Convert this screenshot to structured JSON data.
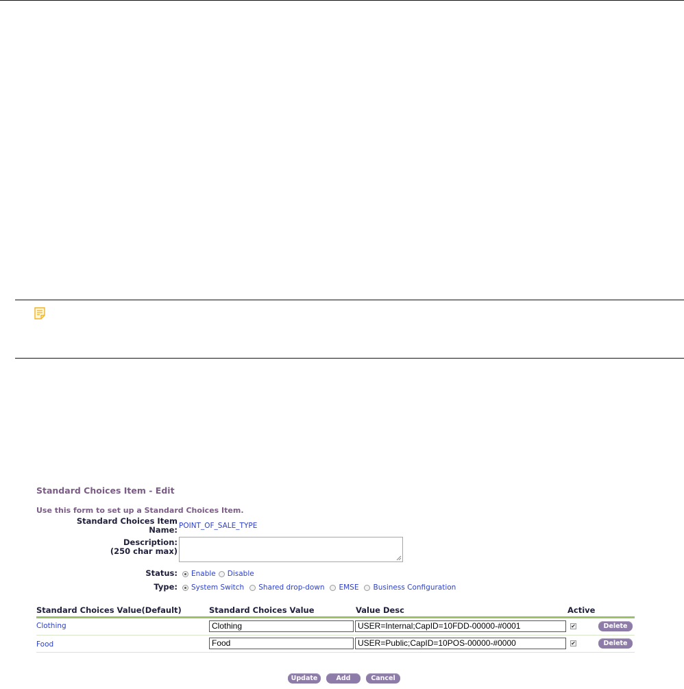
{
  "form": {
    "title": "Standard Choices Item - Edit",
    "intro": "Use this form to set up a Standard Choices Item.",
    "name_label_line1": "Standard Choices Item",
    "name_label_line2": "Name:",
    "name_value": "POINT_OF_SALE_TYPE",
    "description_label_line1": "Description:",
    "description_label_line2": "(250 char max)",
    "description_value": "",
    "status_label": "Status:",
    "status_options": [
      "Enable",
      "Disable"
    ],
    "status_selected": "Enable",
    "type_label": "Type:",
    "type_options": [
      "System Switch",
      "Shared drop-down",
      "EMSE",
      "Business Configuration"
    ],
    "type_selected": "System Switch"
  },
  "table": {
    "headers": [
      "Standard Choices Value(Default)",
      "Standard Choices Value",
      "Value Desc",
      "Active"
    ],
    "rows": [
      {
        "default": "Clothing",
        "value": "Clothing",
        "desc": "USER=Internal;CapID=10FDD-00000-#0001",
        "active": true,
        "delete": "Delete"
      },
      {
        "default": "Food",
        "value": "Food",
        "desc": "USER=Public;CapID=10POS-00000-#0000",
        "active": true,
        "delete": "Delete"
      }
    ]
  },
  "buttons": {
    "update": "Update",
    "add": "Add",
    "cancel": "Cancel"
  },
  "colors": {
    "heading": "#7a5c84",
    "link": "#2c3fc8",
    "button": "#8d7ca7",
    "table_rule": "#9bc267",
    "note_icon": "#f0b429"
  },
  "icons": {
    "note": "note-icon"
  }
}
